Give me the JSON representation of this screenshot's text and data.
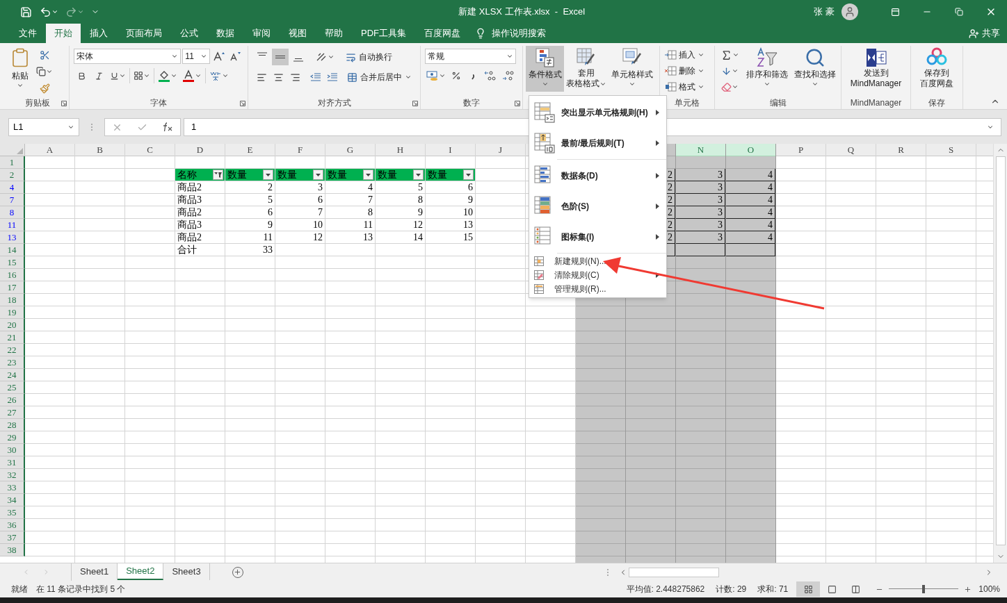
{
  "title_bar": {
    "title": "新建 XLSX 工作表.xlsx  -  Excel",
    "user": "张 豪"
  },
  "menu_tabs": [
    {
      "label": "文件",
      "selected": false
    },
    {
      "label": "开始",
      "selected": true
    },
    {
      "label": "插入",
      "selected": false
    },
    {
      "label": "页面布局",
      "selected": false
    },
    {
      "label": "公式",
      "selected": false
    },
    {
      "label": "数据",
      "selected": false
    },
    {
      "label": "审阅",
      "selected": false
    },
    {
      "label": "视图",
      "selected": false
    },
    {
      "label": "帮助",
      "selected": false
    },
    {
      "label": "PDF工具集",
      "selected": false
    },
    {
      "label": "百度网盘",
      "selected": false
    }
  ],
  "tell_me": {
    "label": "操作说明搜索"
  },
  "share": "共享",
  "ribbon": {
    "clipboard": {
      "label": "剪贴板",
      "paste": "粘贴"
    },
    "font": {
      "label": "字体",
      "font_name": "宋体",
      "font_size": "11"
    },
    "alignment": {
      "label": "对齐方式",
      "vertical": [
        {
          "selected": false
        },
        {
          "selected": true
        },
        {
          "selected": false
        }
      ],
      "wrap": "自动换行",
      "merge": "合并后居中"
    },
    "number": {
      "label": "数字",
      "format": "常规"
    },
    "styles": {
      "conditional": {
        "label": "条件格式",
        "pressed": true
      },
      "table_format": [
        "套用",
        "表格格式"
      ],
      "cell_styles": "单元格样式"
    },
    "cells": {
      "label": "单元格",
      "items": [
        "插入",
        "删除",
        "格式"
      ]
    },
    "editing": {
      "label": "编辑",
      "sort": "排序和筛选",
      "find": "查找和选择"
    },
    "mindmanager": {
      "label": "MindManager",
      "send": [
        "发送到",
        "MindManager"
      ]
    },
    "save": {
      "label": "保存",
      "button": [
        "保存到",
        "百度网盘"
      ]
    }
  },
  "formula_bar": {
    "name_box": "L1",
    "value": "1"
  },
  "grid": {
    "columns": [
      {
        "label": "A",
        "selected": false
      },
      {
        "label": "B",
        "selected": false
      },
      {
        "label": "C",
        "selected": false
      },
      {
        "label": "D",
        "selected": false
      },
      {
        "label": "E",
        "selected": false
      },
      {
        "label": "F",
        "selected": false
      },
      {
        "label": "G",
        "selected": false
      },
      {
        "label": "H",
        "selected": false
      },
      {
        "label": "I",
        "selected": false
      },
      {
        "label": "J",
        "selected": false
      },
      {
        "selected": false
      },
      {
        "selected": true
      },
      {
        "selected": true
      },
      {
        "label": "N",
        "selected": true
      },
      {
        "label": "O",
        "selected": true
      },
      {
        "label": "P",
        "selected": false
      },
      {
        "label": "Q",
        "selected": false
      },
      {
        "label": "R",
        "selected": false
      },
      {
        "label": "S",
        "selected": false
      }
    ],
    "rows": [
      {
        "label": "1",
        "filtered": false
      },
      {
        "label": "2",
        "filtered": false,
        "cells": [
          null,
          null,
          null,
          {
            "kind": "header",
            "text": "名称",
            "filtered": true
          },
          {
            "kind": "header",
            "text": "数量",
            "filtered": false
          },
          {
            "kind": "header",
            "text": "数量",
            "filtered": false
          },
          {
            "kind": "header",
            "text": "数量",
            "filtered": false
          },
          {
            "kind": "header",
            "text": "数量",
            "filtered": false
          },
          {
            "kind": "header",
            "text": "数量",
            "filtered": false
          },
          null,
          null,
          null,
          {
            "kind": "boxed",
            "text": "2"
          },
          {
            "kind": "boxed",
            "text": "3"
          },
          {
            "kind": "boxed",
            "text": "4"
          }
        ]
      },
      {
        "label": "4",
        "filtered": true,
        "cells": [
          null,
          null,
          null,
          {
            "kind": "text",
            "text": "商品2"
          },
          {
            "kind": "number",
            "text": "2"
          },
          {
            "kind": "number",
            "text": "3"
          },
          {
            "kind": "number",
            "text": "4"
          },
          {
            "kind": "number",
            "text": "5"
          },
          {
            "kind": "number",
            "text": "6"
          },
          null,
          null,
          null,
          {
            "kind": "boxed",
            "text": "2"
          },
          {
            "kind": "boxed",
            "text": "3"
          },
          {
            "kind": "boxed",
            "text": "4"
          }
        ]
      },
      {
        "label": "7",
        "filtered": true,
        "cells": [
          null,
          null,
          null,
          {
            "kind": "text",
            "text": "商品3"
          },
          {
            "kind": "number",
            "text": "5"
          },
          {
            "kind": "number",
            "text": "6"
          },
          {
            "kind": "number",
            "text": "7"
          },
          {
            "kind": "number",
            "text": "8"
          },
          {
            "kind": "number",
            "text": "9"
          },
          null,
          null,
          null,
          {
            "kind": "boxed",
            "text": "2"
          },
          {
            "kind": "boxed",
            "text": "3"
          },
          {
            "kind": "boxed",
            "text": "4"
          }
        ]
      },
      {
        "label": "8",
        "filtered": true,
        "cells": [
          null,
          null,
          null,
          {
            "kind": "text",
            "text": "商品2"
          },
          {
            "kind": "number",
            "text": "6"
          },
          {
            "kind": "number",
            "text": "7"
          },
          {
            "kind": "number",
            "text": "8"
          },
          {
            "kind": "number",
            "text": "9"
          },
          {
            "kind": "number",
            "text": "10"
          },
          null,
          null,
          null,
          {
            "kind": "boxed",
            "text": "2"
          },
          {
            "kind": "boxed",
            "text": "3"
          },
          {
            "kind": "boxed",
            "text": "4"
          }
        ]
      },
      {
        "label": "11",
        "filtered": true,
        "cells": [
          null,
          null,
          null,
          {
            "kind": "text",
            "text": "商品3"
          },
          {
            "kind": "number",
            "text": "9"
          },
          {
            "kind": "number",
            "text": "10"
          },
          {
            "kind": "number",
            "text": "11"
          },
          {
            "kind": "number",
            "text": "12"
          },
          {
            "kind": "number",
            "text": "13"
          },
          null,
          null,
          null,
          {
            "kind": "boxed",
            "text": "2"
          },
          {
            "kind": "boxed",
            "text": "3"
          },
          {
            "kind": "boxed",
            "text": "4"
          }
        ]
      },
      {
        "label": "13",
        "filtered": true,
        "cells": [
          null,
          null,
          null,
          {
            "kind": "text",
            "text": "商品2"
          },
          {
            "kind": "number",
            "text": "11"
          },
          {
            "kind": "number",
            "text": "12"
          },
          {
            "kind": "number",
            "text": "13"
          },
          {
            "kind": "number",
            "text": "14"
          },
          {
            "kind": "number",
            "text": "15"
          },
          null,
          null,
          null,
          {
            "kind": "boxed",
            "text": "2"
          },
          {
            "kind": "boxed",
            "text": "3"
          },
          {
            "kind": "boxed",
            "text": "4"
          }
        ]
      },
      {
        "label": "14",
        "filtered": false,
        "cells": [
          null,
          null,
          null,
          {
            "kind": "text",
            "text": "合计"
          },
          {
            "kind": "number",
            "text": "33"
          },
          null,
          null,
          null,
          null,
          null,
          null,
          null,
          {
            "kind": "boxed"
          },
          {
            "kind": "boxed"
          },
          {
            "kind": "boxed"
          }
        ]
      },
      {
        "label": "15",
        "filtered": false
      },
      {
        "label": "16",
        "filtered": false
      },
      {
        "label": "17",
        "filtered": false
      },
      {
        "label": "18",
        "filtered": false
      },
      {
        "label": "19",
        "filtered": false
      },
      {
        "label": "20",
        "filtered": false
      },
      {
        "label": "21",
        "filtered": false
      },
      {
        "label": "22",
        "filtered": false
      },
      {
        "label": "23",
        "filtered": false
      },
      {
        "label": "24",
        "filtered": false
      },
      {
        "label": "25",
        "filtered": false
      },
      {
        "label": "26",
        "filtered": false
      },
      {
        "label": "27",
        "filtered": false
      },
      {
        "label": "28",
        "filtered": false
      },
      {
        "label": "29",
        "filtered": false
      },
      {
        "label": "30",
        "filtered": false
      },
      {
        "label": "31",
        "filtered": false
      },
      {
        "label": "32",
        "filtered": false
      },
      {
        "label": "33",
        "filtered": false
      },
      {
        "label": "34",
        "filtered": false
      },
      {
        "label": "35",
        "filtered": false
      },
      {
        "label": "36",
        "filtered": false
      },
      {
        "label": "37",
        "filtered": false
      },
      {
        "label": "38",
        "filtered": false
      }
    ]
  },
  "cf_menu": {
    "items": [
      {
        "kind": "large",
        "label": "突出显示单元格规则(H)",
        "submenu": true
      },
      {
        "kind": "large",
        "label": "最前/最后规则(T)",
        "submenu": true
      },
      {
        "kind": "large",
        "label": "数据条(D)",
        "submenu": true
      },
      {
        "kind": "large",
        "label": "色阶(S)",
        "submenu": true
      },
      {
        "kind": "large",
        "label": "图标集(I)",
        "submenu": true
      },
      {
        "kind": "small",
        "label": "新建规则(N)...",
        "submenu": false
      },
      {
        "kind": "small",
        "label": "清除规则(C)",
        "submenu": true
      },
      {
        "kind": "small",
        "label": "管理规则(R)...",
        "submenu": false
      }
    ]
  },
  "sheets": [
    {
      "label": "Sheet1",
      "selected": false
    },
    {
      "label": "Sheet2",
      "selected": true
    },
    {
      "label": "Sheet3",
      "selected": false
    }
  ],
  "status_bar": {
    "mode": "就绪",
    "filter_info": "在 11 条记录中找到 5 个",
    "average": "平均值: 2.448275862",
    "count": "计数: 29",
    "sum": "求和: 71",
    "views": [
      {
        "selected": true
      },
      {
        "selected": false
      },
      {
        "selected": false
      }
    ],
    "zoom": {
      "level": 0.5,
      "label": "100%"
    }
  }
}
